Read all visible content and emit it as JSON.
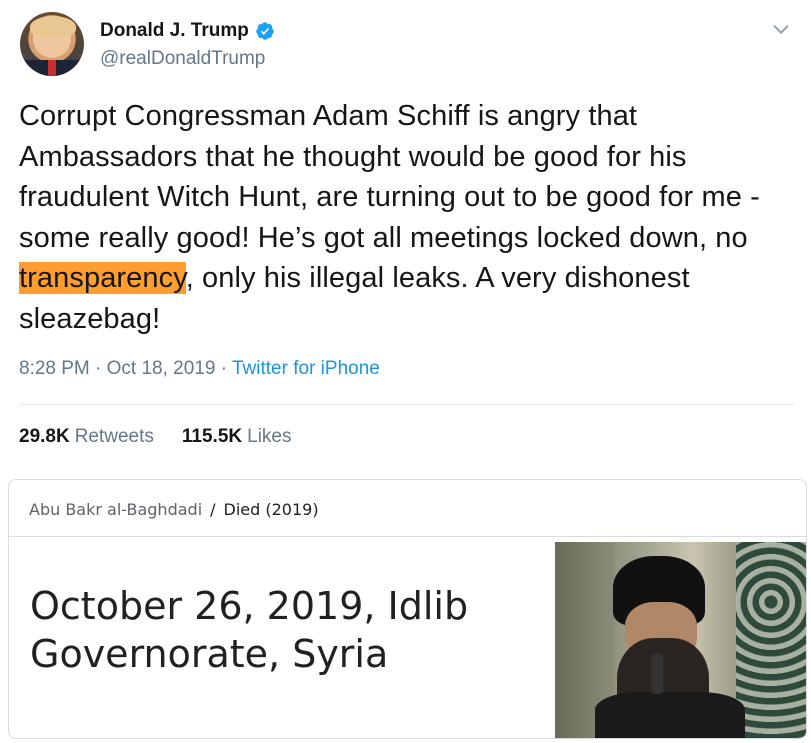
{
  "tweet": {
    "author_name": "Donald J. Trump",
    "handle": "@realDonaldTrump",
    "text_before": "Corrupt Congressman Adam Schiff is angry that Ambassadors that he thought would be good for his fraudulent Witch Hunt, are turning out to be good for me - some really good! He’s got all meetings locked down, no ",
    "text_highlight": "transparency",
    "text_after": ", only his illegal leaks. A very dishonest sleazebag!",
    "time": "8:28 PM",
    "dot1": " · ",
    "date": "Oct 18, 2019",
    "dot2": " · ",
    "source": "Twitter for iPhone",
    "retweets_count": "29.8K",
    "retweets_label": "Retweets",
    "likes_count": "115.5K",
    "likes_label": "Likes",
    "highlight_color": "#ff9d2e",
    "icons": [
      "verified-badge-icon",
      "chevron-down-icon"
    ]
  },
  "card": {
    "breadcrumb": [
      "Abu Bakr al-Baghdadi",
      "/",
      "Died (2019)"
    ],
    "answer": "October 26, 2019, Idlib Governorate, Syria"
  }
}
